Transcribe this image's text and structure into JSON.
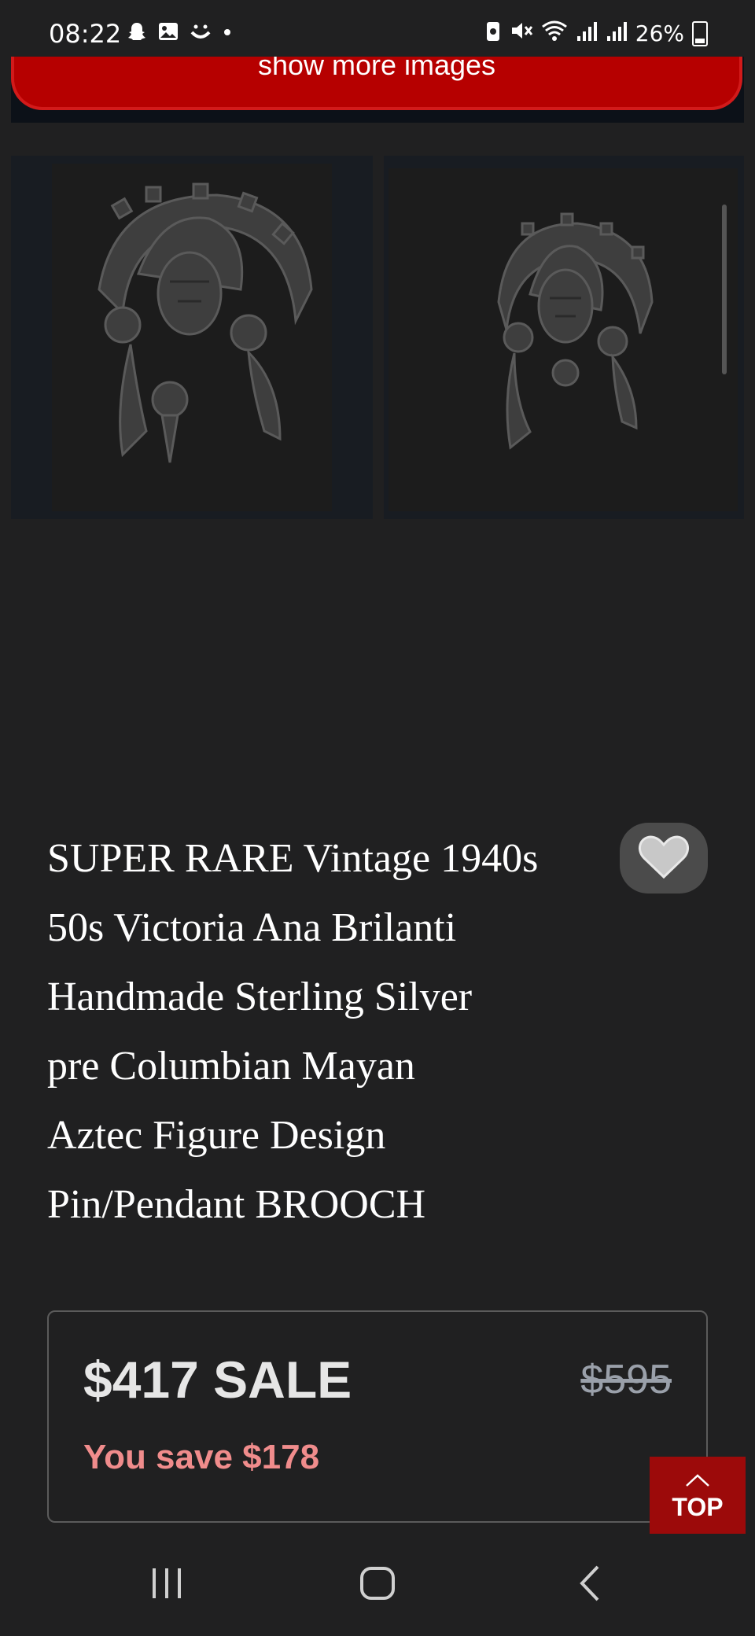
{
  "status_bar": {
    "time": "08:22",
    "left_icons": [
      "snapchat-icon",
      "gallery-icon",
      "smile-icon",
      "dot-icon"
    ],
    "right_icons": [
      "battery-saver-icon",
      "mute-icon",
      "wifi-icon",
      "signal-icon",
      "signal-icon"
    ],
    "battery": "26%"
  },
  "gallery": {
    "more_label": "show more images",
    "thumbnails": [
      "brooch-image-1",
      "brooch-image-2"
    ]
  },
  "product": {
    "title_lines": [
      "SUPER RARE Vintage 1940s",
      "50s Victoria Ana Brilanti",
      "Handmade Sterling Silver",
      "pre Columbian Mayan",
      "Aztec Figure Design",
      "Pin/Pendant BROOCH"
    ],
    "favorite_icon": "heart-icon"
  },
  "pricing": {
    "sale_price": "$417 SALE",
    "original_price": "$595",
    "savings": "You save $178"
  },
  "top_button": {
    "label": "TOP",
    "icon": "chevron-up-icon"
  },
  "nav_bar": {
    "buttons": [
      "recents-icon",
      "home-icon",
      "back-icon"
    ]
  },
  "colors": {
    "background": "#202021",
    "accent_red": "#b60000",
    "savings_pink": "#f08c8c"
  }
}
